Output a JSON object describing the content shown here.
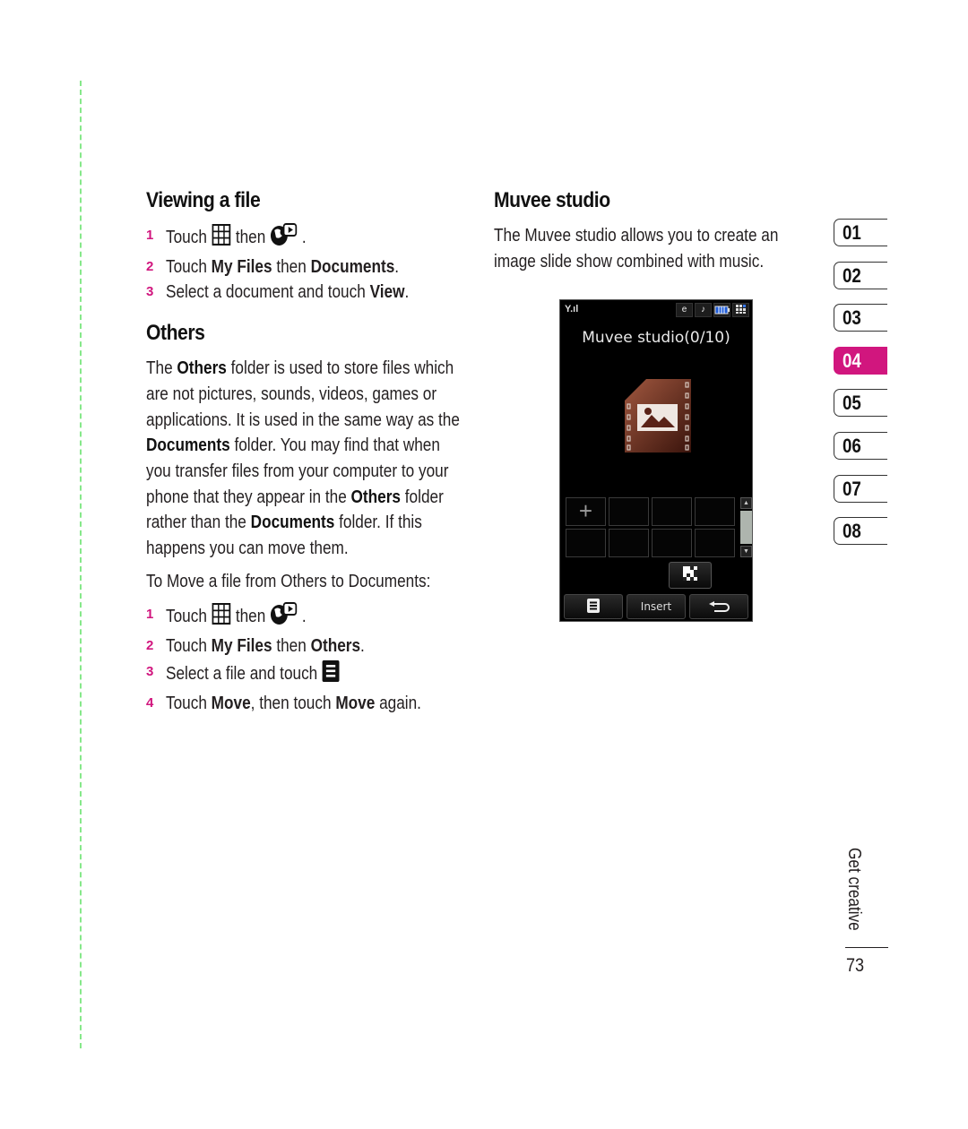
{
  "left": {
    "viewing": {
      "title": "Viewing a file",
      "steps": [
        {
          "num": "1",
          "t1": "Touch ",
          "t2": " then ",
          "t3": "."
        },
        {
          "num": "2",
          "t1": "Touch ",
          "b1": "My Files",
          "t2": " then ",
          "b2": "Documents",
          "t3": "."
        },
        {
          "num": "3",
          "t1": "Select a document and touch ",
          "b1": "View",
          "t2": "."
        }
      ]
    },
    "others": {
      "title": "Others",
      "para": [
        {
          "t": "The "
        },
        {
          "b": "Others"
        },
        {
          "t": " folder is used to store files which"
        },
        {
          "br": true
        },
        {
          "t": "are not pictures, sounds, videos, games or"
        },
        {
          "br": true
        },
        {
          "t": "applications. It is used in the same way as the"
        },
        {
          "br": true
        },
        {
          "b": "Documents"
        },
        {
          "t": " folder. You may find that when"
        },
        {
          "br": true
        },
        {
          "t": "you transfer files from your computer to your"
        },
        {
          "br": true
        },
        {
          "t": "phone that they appear in the "
        },
        {
          "b": "Others"
        },
        {
          "t": " folder"
        },
        {
          "br": true
        },
        {
          "t": "rather than the "
        },
        {
          "b": "Documents"
        },
        {
          "t": " folder. If this"
        },
        {
          "br": true
        },
        {
          "t": "happens you can move them."
        }
      ],
      "move_intro": "To Move a file from Others to Documents:",
      "steps": [
        {
          "num": "1",
          "t1": "Touch ",
          "t2": " then ",
          "t3": "."
        },
        {
          "num": "2",
          "t1": "Touch ",
          "b1": "My Files",
          "t2": " then ",
          "b2": "Others",
          "t3": "."
        },
        {
          "num": "3",
          "t1": "Select a file and touch "
        },
        {
          "num": "4",
          "t1": "Touch ",
          "b1": "Move",
          "t2": ", then touch ",
          "b2": "Move",
          "t3": " again."
        }
      ]
    }
  },
  "mid": {
    "title": "Muvee studio",
    "line1": "The Muvee studio allows you to create an",
    "line2": "image slide show combined with music.",
    "phone": {
      "signal": "Y.ıl",
      "status_icons": [
        "e-mail-icon",
        "music-note-icon",
        "battery-icon",
        "menu-grid-icon"
      ],
      "screen_title": "Muvee studio(0/10)",
      "add_cell": "+",
      "softkeys": {
        "menu": "≡",
        "insert": "Insert",
        "back": "↩"
      }
    }
  },
  "tabs": {
    "items": [
      "01",
      "02",
      "03",
      "04",
      "05",
      "06",
      "07",
      "08"
    ],
    "active": "04",
    "active_color": "#d1167e"
  },
  "footer": {
    "section": "Get creative",
    "page": "73"
  }
}
